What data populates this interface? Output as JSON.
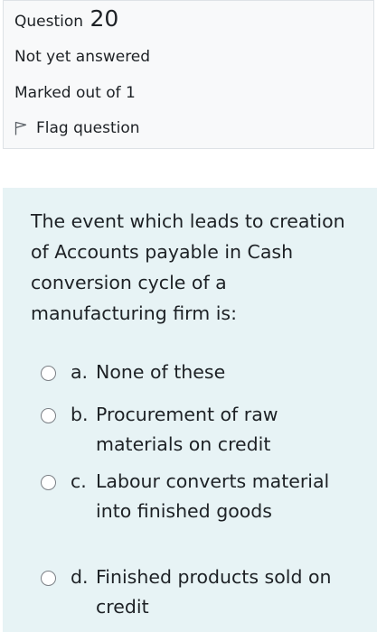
{
  "question": {
    "label": "Question",
    "number": "20",
    "state": "Not yet answered",
    "grade": "Marked out of 1",
    "flag_label": "Flag question",
    "text": "The event which leads to creation of Accounts payable in Cash conversion cycle of a manufacturing firm is:"
  },
  "answers": [
    {
      "letter": "a.",
      "text": "None of these"
    },
    {
      "letter": "b.",
      "text": "Procurement of raw materials on credit"
    },
    {
      "letter": "c.",
      "text": "Labour converts material into finished goods"
    },
    {
      "letter": "d.",
      "text": "Finished products sold on credit"
    }
  ],
  "icons": {
    "flag": "flag-icon",
    "radio": "radio-unchecked-icon"
  },
  "colors": {
    "info_background": "#f8f9fa",
    "content_background": "#e7f3f5",
    "text": "#1d2125"
  }
}
